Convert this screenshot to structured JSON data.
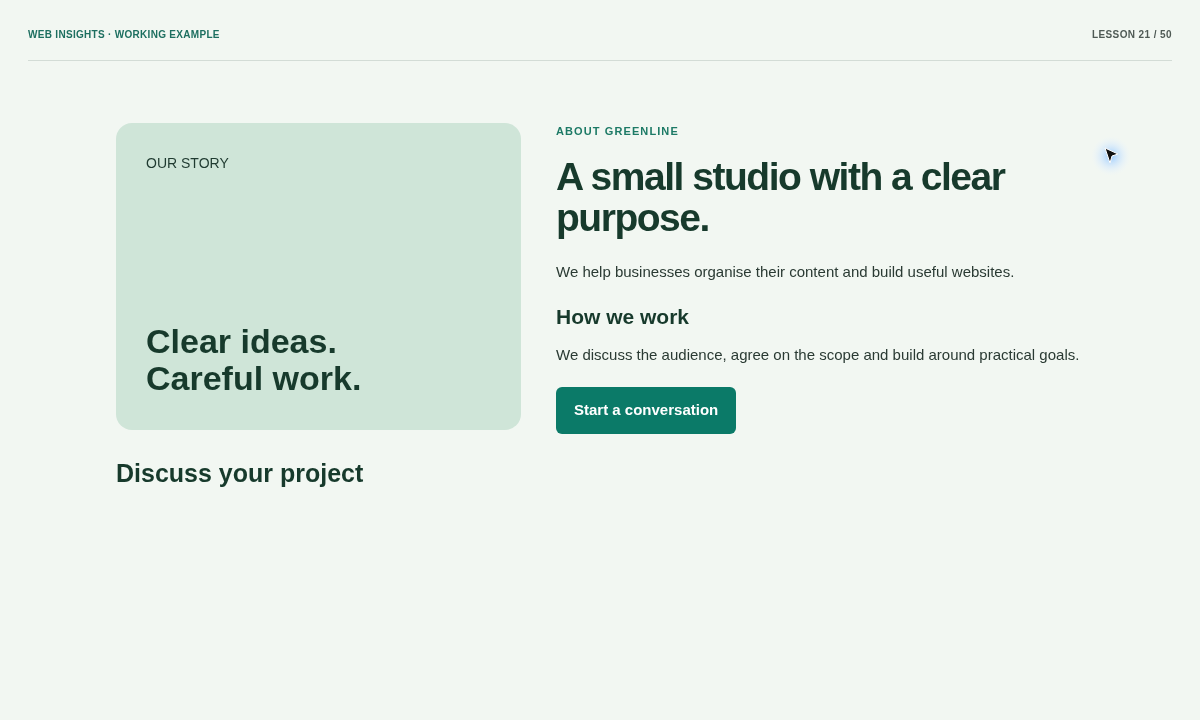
{
  "header": {
    "brand": "WEB INSIGHTS · WORKING EXAMPLE",
    "lesson": "LESSON 21 / 50"
  },
  "story_card": {
    "label": "OUR STORY",
    "headline_lines": [
      "Clear ideas.",
      "Careful work."
    ]
  },
  "left_heading": "Discuss your project",
  "about": {
    "eyebrow": "ABOUT GREENLINE",
    "title": "A small studio with a clear purpose.",
    "intro": "We help businesses organise their content and build useful websites.",
    "subheading": "How we work",
    "body": "We discuss the audience, agree on the scope and build around practical goals.",
    "button": "Start a conversation"
  }
}
